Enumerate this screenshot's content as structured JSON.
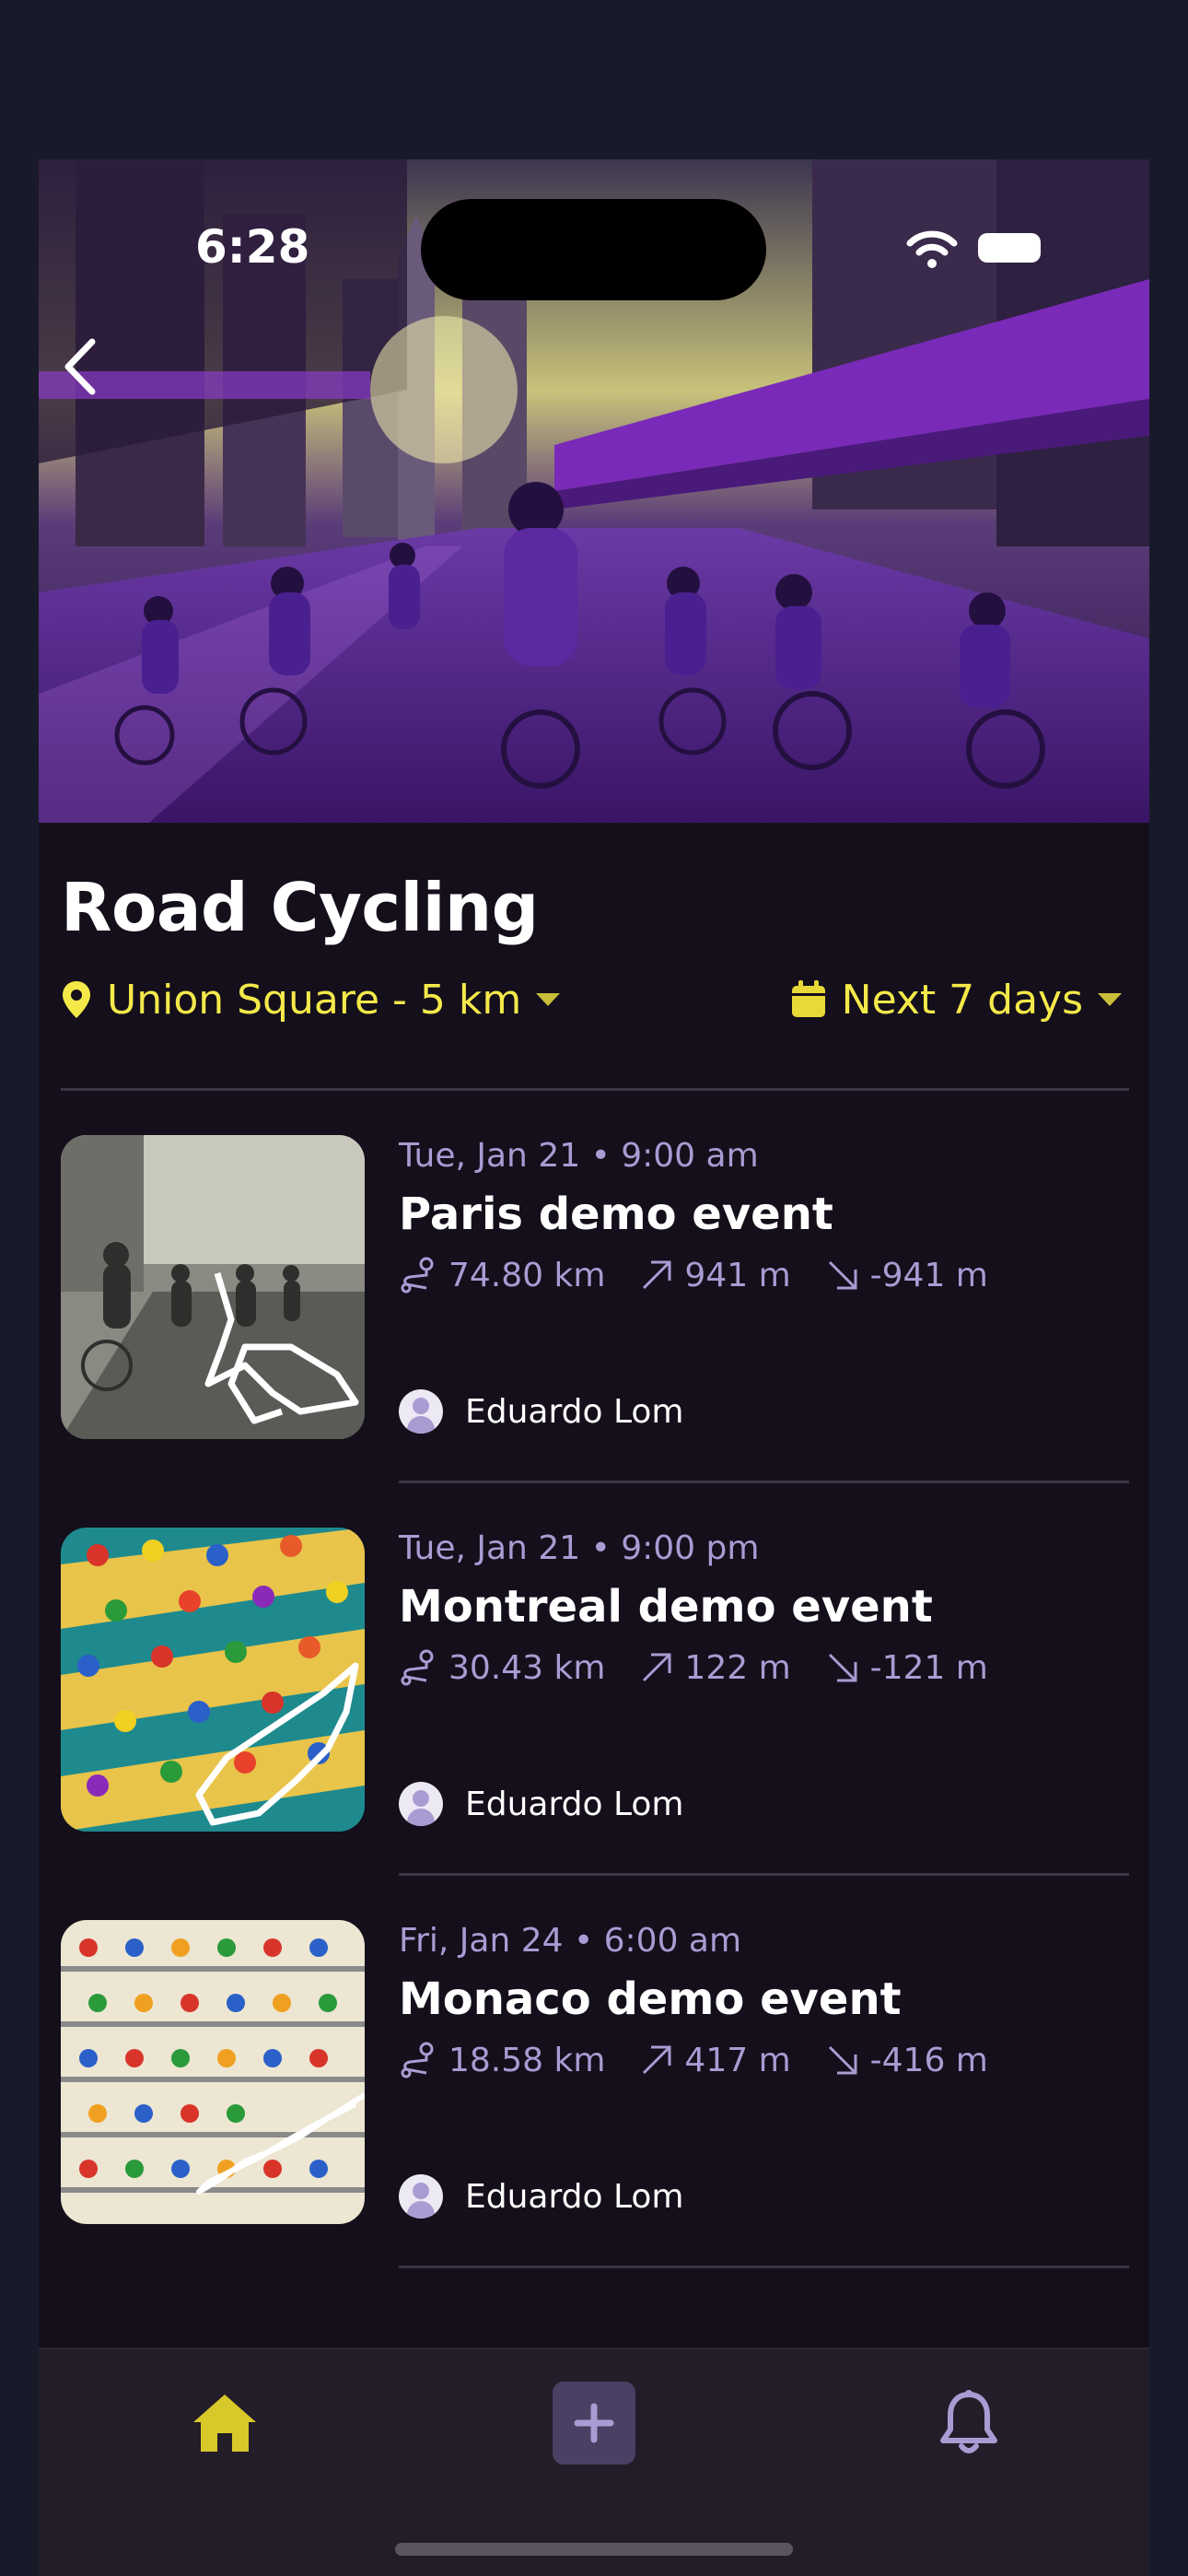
{
  "status": {
    "time": "6:28"
  },
  "hero": {
    "image": "cyclists-purple-city-street"
  },
  "page": {
    "title": "Road Cycling"
  },
  "filters": {
    "location": "Union Square - 5 km",
    "date_range": "Next 7 days",
    "accent_color": "#f5e94a"
  },
  "events": [
    {
      "date": "Tue, Jan 21 • 9:00 am",
      "name": "Paris demo event",
      "distance": "74.80 km",
      "ascent": "941 m",
      "descent": "-941 m",
      "owner": "Eduardo Lom"
    },
    {
      "date": "Tue, Jan 21 • 9:00 pm",
      "name": "Montreal demo event",
      "distance": "30.43 km",
      "ascent": "122 m",
      "descent": "-121 m",
      "owner": "Eduardo Lom"
    },
    {
      "date": "Fri, Jan 24 • 6:00 am",
      "name": "Monaco demo event",
      "distance": "18.58 km",
      "ascent": "417 m",
      "descent": "-416 m",
      "owner": "Eduardo Lom"
    }
  ],
  "tabbar": {
    "items": [
      {
        "icon": "home-icon",
        "active": true
      },
      {
        "icon": "plus-icon",
        "active": false
      },
      {
        "icon": "bell-icon",
        "active": false
      }
    ]
  }
}
